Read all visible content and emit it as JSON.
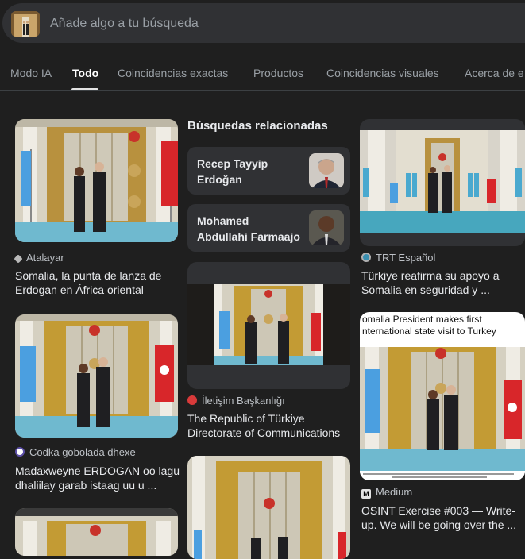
{
  "search": {
    "placeholder": "Añade algo a tu búsqueda"
  },
  "tabs": [
    {
      "label": "Modo IA"
    },
    {
      "label": "Todo"
    },
    {
      "label": "Coincidencias exactas"
    },
    {
      "label": "Productos"
    },
    {
      "label": "Coincidencias visuales"
    },
    {
      "label": "Acerca de e"
    }
  ],
  "related": {
    "heading": "Búsquedas relacionadas",
    "items": [
      {
        "label": "Recep Tayyip Erdoğan"
      },
      {
        "label": "Mohamed Abdullahi Farmaajo"
      }
    ]
  },
  "results": [
    {
      "source": "Atalayar",
      "title": "Somalia, la punta de lanza de Erdogan en África oriental"
    },
    {
      "source": "Codka gobolada dhexe",
      "title": "Madaxweyne ERDOGAN oo lagu dhaliilay garab istaag uu u ..."
    },
    {
      "source": "İletişim Başkanlığı",
      "title": "The Republic of Türkiye Directorate of Communications"
    },
    {
      "source": "TRT Español",
      "title": "Türkiye reafirma su apoyo a Somalia en seguridad y ..."
    },
    {
      "source": "Medium",
      "title": "OSINT Exercise #003 — Write-up. We will be going over the ..."
    }
  ],
  "medium_card": {
    "headline_line1": "omalia President makes first",
    "headline_line2": "nternational state visit to Turkey",
    "source_icon": "M"
  },
  "colors": {
    "background": "#1f1f1f",
    "searchbar": "#303134",
    "related_bg": "#303134",
    "muted_text": "#9aa0a6"
  }
}
